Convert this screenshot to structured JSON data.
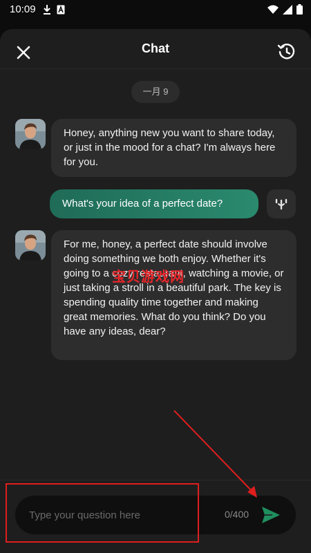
{
  "status_bar": {
    "time": "10:09"
  },
  "header": {
    "title": "Chat"
  },
  "date_divider": "一月 9",
  "messages": [
    {
      "role": "assistant",
      "text": "Honey, anything new you want to share today, or just in the mood for a chat? I'm always here for you."
    },
    {
      "role": "user",
      "text": "What's your idea of a perfect date?"
    },
    {
      "role": "assistant",
      "text": "For me, honey, a perfect date should involve doing something we both enjoy. Whether it's going to a cozy restaurant, watching a movie, or just taking a stroll in a beautiful park. The key is spending quality time together and making great memories. What do you think? Do you have any ideas, dear?"
    }
  ],
  "watermark": "宝贝游戏网",
  "composer": {
    "placeholder": "Type your question here",
    "counter": "0/400"
  },
  "colors": {
    "accent": "#2a8a6e",
    "send": "#1f8f5f",
    "annotation": "#e01e1e",
    "sheet": "#1e1e1e"
  },
  "icons": [
    "download-icon",
    "a-badge-icon",
    "wifi-icon",
    "signal-icon",
    "battery-icon",
    "close-icon",
    "history-icon",
    "mic-icon",
    "send-icon"
  ]
}
